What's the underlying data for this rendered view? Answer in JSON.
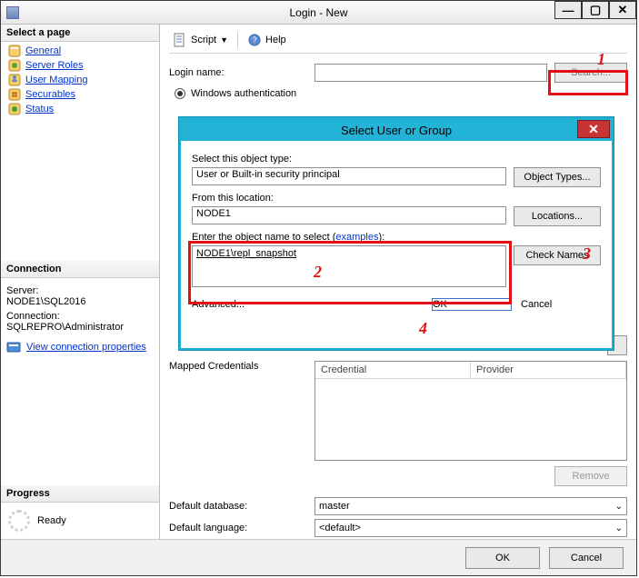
{
  "window": {
    "title": "Login - New"
  },
  "left": {
    "select_page": "Select a page",
    "pages": [
      "General",
      "Server Roles",
      "User Mapping",
      "Securables",
      "Status"
    ],
    "connection_hdr": "Connection",
    "server_lbl": "Server:",
    "server_val": "NODE1\\SQL2016",
    "conn_lbl": "Connection:",
    "conn_val": "SQLREPRO\\Administrator",
    "connprops": "View connection properties",
    "progress_hdr": "Progress",
    "progress_txt": "Ready"
  },
  "toolbar": {
    "script": "Script",
    "help": "Help"
  },
  "form": {
    "login_name_lbl": "Login name:",
    "login_name_val": "",
    "search_btn": "Search...",
    "winauth": "Windows authentication",
    "mapped_lbl": "Mapped Credentials",
    "cred_col": "Credential",
    "prov_col": "Provider",
    "remove_btn": "Remove",
    "defdb_lbl": "Default database:",
    "defdb_val": "master",
    "deflang_lbl": "Default language:",
    "deflang_val": "<default>"
  },
  "bottom": {
    "ok": "OK",
    "cancel": "Cancel"
  },
  "modal": {
    "title": "Select User or Group",
    "objtype_lbl": "Select this object type:",
    "objtype_val": "User or Built-in security principal",
    "objtype_btn": "Object Types...",
    "loc_lbl": "From this location:",
    "loc_val": "NODE1",
    "loc_btn": "Locations...",
    "names_lbl_a": "Enter the object name to select (",
    "names_link": "examples",
    "names_lbl_b": "):",
    "names_val": "NODE1\\repl_snapshot",
    "check_btn": "Check Names",
    "advanced": "Advanced...",
    "ok": "OK",
    "cancel": "Cancel"
  },
  "annotations": {
    "n1": "1",
    "n2": "2",
    "n3": "3",
    "n4": "4"
  }
}
